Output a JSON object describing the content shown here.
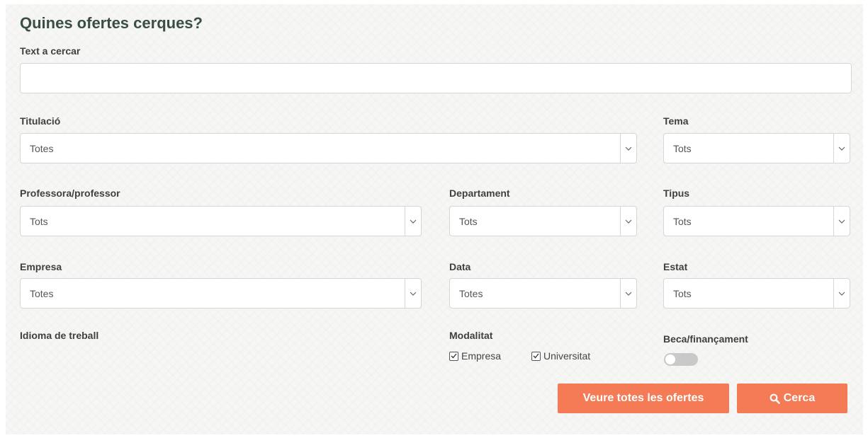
{
  "form": {
    "title": "Quines ofertes cerques?",
    "search_text": {
      "label": "Text a cercar",
      "value": ""
    },
    "titulacio": {
      "label": "Titulació",
      "value": "Totes"
    },
    "tema": {
      "label": "Tema",
      "value": "Tots"
    },
    "professor": {
      "label": "Professora/professor",
      "value": "Tots"
    },
    "departament": {
      "label": "Departament",
      "value": "Tots"
    },
    "tipus": {
      "label": "Tipus",
      "value": "Tots"
    },
    "empresa": {
      "label": "Empresa",
      "value": "Totes"
    },
    "data": {
      "label": "Data",
      "value": "Totes"
    },
    "estat": {
      "label": "Estat",
      "value": "Tots"
    },
    "idioma": {
      "label": "Idioma de treball"
    },
    "modalitat": {
      "label": "Modalitat",
      "options": [
        {
          "label": "Empresa",
          "checked": true
        },
        {
          "label": "Universitat",
          "checked": true
        }
      ]
    },
    "beca": {
      "label": "Beca/finançament",
      "enabled": false
    },
    "buttons": {
      "show_all": "Veure totes les ofertes",
      "search": "Cerca",
      "search_icon": "search-icon"
    }
  },
  "colors": {
    "title": "#3a4f41",
    "button": "#f47b55",
    "toggle_off": "#c9c9c9"
  }
}
